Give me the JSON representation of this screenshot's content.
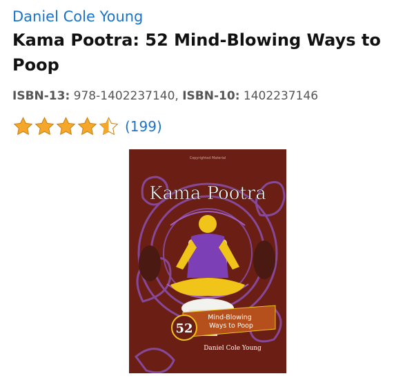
{
  "product": {
    "author": "Daniel Cole Young",
    "title": "Kama Pootra: 52 Mind-Blowing Ways to Poop",
    "isbn13_label": "ISBN-13:",
    "isbn13_value": "978-1402237140",
    "isbn10_label": "ISBN-10:",
    "isbn10_value": "1402237146",
    "rating": 4.5,
    "rating_count": "(199)"
  },
  "cover": {
    "copyright_text": "Copyrighted Material",
    "title_text": "Kama Pootra",
    "badge_number": "52",
    "subtitle_line1": "Mind-Blowing",
    "subtitle_line2": "Ways to Poop",
    "author_text": "Daniel Cole Young",
    "colors": {
      "background": "#6b1f14",
      "ornament": "#8a4ea8",
      "figure_shirt": "#7d3fb5",
      "figure_skin": "#f0c419",
      "banner": "#b5501d",
      "toilet": "#f2f2ee"
    }
  },
  "colors": {
    "link": "#1a73c8",
    "star": "#f4a72a"
  }
}
